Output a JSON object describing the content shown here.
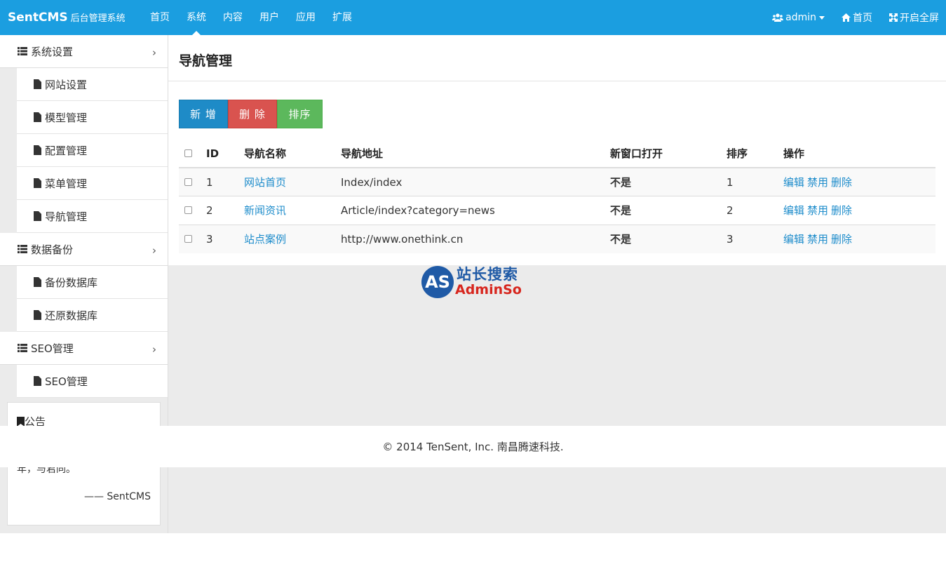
{
  "navbar": {
    "brand": "SentCMS",
    "brand_sub": "后台管理系统",
    "menu": [
      "首页",
      "系统",
      "内容",
      "用户",
      "应用",
      "扩展"
    ],
    "active": "系统",
    "user": "admin",
    "home": "首页",
    "fullscreen": "开启全屏"
  },
  "sidebar": {
    "groups": [
      {
        "label": "系统设置",
        "items": [
          "网站设置",
          "模型管理",
          "配置管理",
          "菜单管理",
          "导航管理"
        ]
      },
      {
        "label": "数据备份",
        "items": [
          "备份数据库",
          "还原数据库"
        ]
      },
      {
        "label": "SEO管理",
        "items": [
          "SEO管理"
        ]
      }
    ],
    "notice": {
      "title": "公告",
      "text": "年，与君同。",
      "sign": "—— SentCMS"
    }
  },
  "page": {
    "title": "导航管理",
    "buttons": {
      "add": "新 增",
      "delete": "删 除",
      "sort": "排序"
    }
  },
  "table": {
    "headers": [
      "ID",
      "导航名称",
      "导航地址",
      "新窗口打开",
      "排序",
      "操作"
    ],
    "rows": [
      {
        "id": "1",
        "name": "网站首页",
        "url": "Index/index",
        "new_window": "不是",
        "sort": "1"
      },
      {
        "id": "2",
        "name": "新闻资讯",
        "url": "Article/index?category=news",
        "new_window": "不是",
        "sort": "2"
      },
      {
        "id": "3",
        "name": "站点案例",
        "url": "http://www.onethink.cn",
        "new_window": "不是",
        "sort": "3"
      }
    ],
    "actions": [
      "编辑",
      "禁用",
      "删除"
    ]
  },
  "watermark": {
    "logo": "AS",
    "cn": "站长搜索",
    "en": "AdminSo"
  },
  "footer": {
    "text": "© 2014 TenSent, Inc. 南昌腾速科技."
  }
}
